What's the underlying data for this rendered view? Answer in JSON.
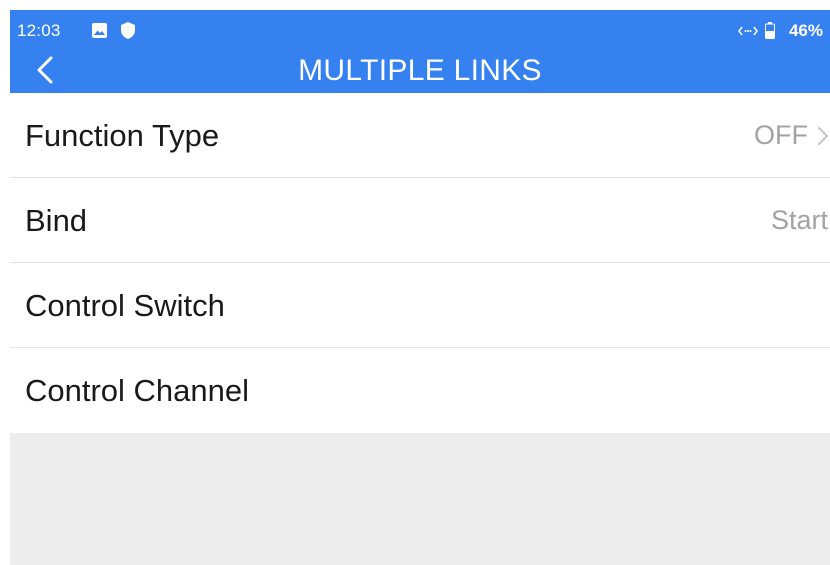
{
  "status_bar": {
    "time": "12:03",
    "battery_percent": "46%",
    "icons": [
      "gallery-icon",
      "shield-icon",
      "signal-icon",
      "battery-icon"
    ]
  },
  "header": {
    "title": "MULTIPLE LINKS",
    "back_icon": "chevron-left-icon"
  },
  "settings": {
    "items": [
      {
        "label": "Function Type",
        "value": "OFF",
        "chevron": true
      },
      {
        "label": "Bind",
        "value": "Start",
        "chevron": false
      },
      {
        "label": "Control Switch",
        "value": "",
        "chevron": false
      },
      {
        "label": "Control Channel",
        "value": "",
        "chevron": false
      }
    ]
  },
  "colors": {
    "header_bg": "#3581ef",
    "header_text": "#ffffff",
    "label_text": "#1a1a1a",
    "value_text": "#a3a3a3",
    "divider": "#e3e3e3",
    "empty_area_bg": "#ededed"
  }
}
